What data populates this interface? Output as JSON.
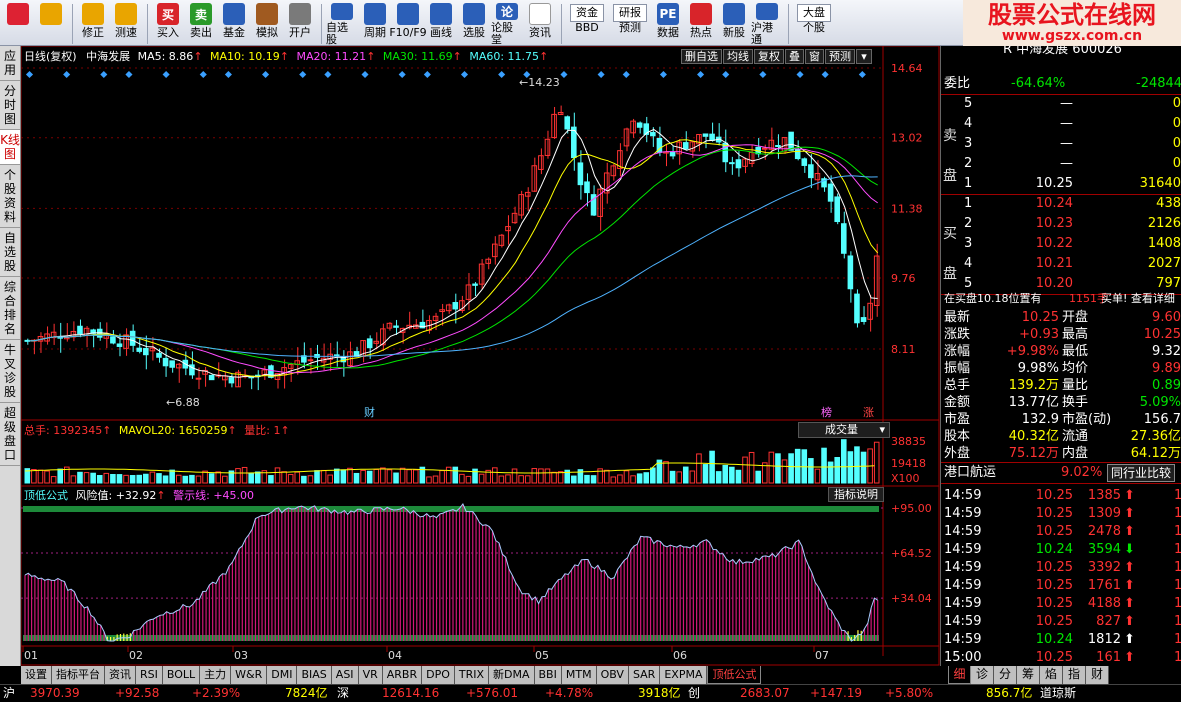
{
  "toolbar": {
    "buttons": [
      {
        "label": "",
        "icon": "window-icon",
        "color": "#d23",
        "name": "window-button"
      },
      {
        "label": "",
        "icon": "back-arrow-icon",
        "color": "#e9a500",
        "name": "back-button"
      },
      {
        "label": "修正",
        "icon": "up-arrow-icon",
        "color": "#e9a500",
        "name": "fix-button"
      },
      {
        "label": "测速",
        "icon": "clock-icon",
        "color": "#e9a500",
        "name": "speed-button"
      },
      {
        "label": "买入",
        "icon": "buy-icon",
        "color": "#d8242a",
        "name": "buy-button",
        "text": "买"
      },
      {
        "label": "卖出",
        "icon": "sell-icon",
        "color": "#2a9a2a",
        "name": "sell-button",
        "text": "卖"
      },
      {
        "label": "基金",
        "icon": "fund-icon",
        "color": "#2b5fb8",
        "name": "fund-button"
      },
      {
        "label": "模拟",
        "icon": "hammer-icon",
        "color": "#a05a20",
        "name": "simulate-button"
      },
      {
        "label": "开户",
        "icon": "lock-icon",
        "color": "#7a7a7a",
        "name": "open-account-button"
      },
      {
        "label": "自选股",
        "icon": "star-icon",
        "color": "#2b5fb8",
        "name": "watchlist-button"
      },
      {
        "label": "周期",
        "icon": "clock-cycle-icon",
        "color": "#2b5fb8",
        "name": "period-button"
      },
      {
        "label": "F10/F9",
        "icon": "f10-icon",
        "color": "#2b5fb8",
        "name": "f10-button"
      },
      {
        "label": "画线",
        "icon": "pencil-icon",
        "color": "#2b5fb8",
        "name": "draw-line-button"
      },
      {
        "label": "选股",
        "icon": "select-stock-icon",
        "color": "#2b5fb8",
        "name": "stock-picker-button"
      },
      {
        "label": "论股堂",
        "icon": "forum-icon",
        "color": "#2b5fb8",
        "name": "forum-button",
        "text": "论"
      },
      {
        "label": "资讯",
        "icon": "info-icon",
        "color": "#ffffff",
        "name": "news-button"
      },
      {
        "label": "BBD",
        "icon": "fund-flow-icon",
        "color": "#2b5fb8",
        "name": "bbd-button",
        "top": "资金"
      },
      {
        "label": "预测",
        "icon": "research-icon",
        "color": "#2b5fb8",
        "name": "forecast-button",
        "top": "研报"
      },
      {
        "label": "数据",
        "icon": "pe-icon",
        "color": "#2b5fb8",
        "name": "data-button",
        "text": "PE"
      },
      {
        "label": "热点",
        "icon": "hot-icon",
        "color": "#d8242a",
        "name": "hotspot-button"
      },
      {
        "label": "新股",
        "icon": "new-stock-icon",
        "color": "#2b5fb8",
        "name": "new-stock-button"
      },
      {
        "label": "沪港通",
        "icon": "hk-connect-icon",
        "color": "#2b5fb8",
        "name": "hk-connect-button"
      },
      {
        "label": "个股",
        "icon": "market-icon",
        "color": "#2b5fb8",
        "name": "market-button",
        "top": "大盘"
      }
    ],
    "brand": {
      "title": "股票公式在线网",
      "url": "www.gszx.com.cn"
    }
  },
  "left_tabs": [
    "应用",
    "分时图",
    "K线图",
    "个股资料",
    "自选股",
    "综合排名",
    "牛叉诊股",
    "超级盘口"
  ],
  "left_tab_active": "K线图",
  "chart": {
    "title_bar": {
      "period": "日线(复权)",
      "name": "中海发展",
      "ma5": "MA5: 8.86",
      "ma10": "MA10: 10.19",
      "ma20": "MA20: 11.21",
      "ma30": "MA30: 11.69",
      "ma60": "MA60: 11.75"
    },
    "top_buttons": [
      "删自选",
      "均线",
      "复权",
      "叠",
      "窗",
      "预测"
    ],
    "price_ticks": [
      "14.64",
      "13.02",
      "11.38",
      "9.76",
      "8.11"
    ],
    "high_label": "14.23",
    "low_label": "6.88",
    "markers": {
      "cai1": "财",
      "cai2": "财",
      "bang": "榜",
      "zhang": "涨"
    },
    "vol_title": {
      "total": "总手: 1392345",
      "mavol": "MAVOL20: 1650259",
      "ratio": "量比: 1"
    },
    "vol_select": "成交量",
    "vol_ticks": [
      "38835",
      "19418",
      "X100"
    ],
    "ind_title": {
      "name": "顶低公式",
      "risk": "风险值: +32.92",
      "warn": "警示线: +45.00"
    },
    "ind_button": "指标说明",
    "ind_ticks": [
      "+95.00",
      "+64.52",
      "+34.04"
    ],
    "months": [
      "01",
      "02",
      "03",
      "04",
      "05",
      "06",
      "07"
    ]
  },
  "chart_data": {
    "type": "candlestick",
    "title": "中海发展",
    "xlabel": "",
    "ylabel": "",
    "price_range": [
      6.88,
      14.64
    ],
    "high": 14.23,
    "low": 6.88,
    "ma": {
      "MA5": 8.86,
      "MA10": 10.19,
      "MA20": 11.21,
      "MA30": 11.69,
      "MA60": 11.75
    },
    "volume": {
      "total": 1392345,
      "MAVOL20": 1650259
    },
    "indicator": {
      "name": "顶低公式",
      "risk": 32.92,
      "warning": 45.0
    }
  },
  "right": {
    "header": "R 中海发展 600026",
    "weibi": {
      "label": "委比",
      "pct": "-64.64%",
      "diff": "-24844"
    },
    "sell_label": "卖盘",
    "buy_label": "买盘",
    "sell": [
      {
        "n": "5",
        "p": "—",
        "v": "0"
      },
      {
        "n": "4",
        "p": "—",
        "v": "0"
      },
      {
        "n": "3",
        "p": "—",
        "v": "0"
      },
      {
        "n": "2",
        "p": "—",
        "v": "0"
      },
      {
        "n": "1",
        "p": "10.25",
        "v": "31640"
      }
    ],
    "buy": [
      {
        "n": "1",
        "p": "10.24",
        "v": "438"
      },
      {
        "n": "2",
        "p": "10.23",
        "v": "2126"
      },
      {
        "n": "3",
        "p": "10.22",
        "v": "1408"
      },
      {
        "n": "4",
        "p": "10.21",
        "v": "2027"
      },
      {
        "n": "5",
        "p": "10.20",
        "v": "797"
      }
    ],
    "note": {
      "a": "在买盘10.18位置有",
      "b": "1151手",
      "c": "买单! 查看详细"
    },
    "stats": [
      {
        "l": "最新",
        "v": "10.25",
        "l2": "开盘",
        "v2": "9.60"
      },
      {
        "l": "涨跌",
        "v": "+0.93",
        "l2": "最高",
        "v2": "10.25"
      },
      {
        "l": "涨幅",
        "v": "+9.98%",
        "l2": "最低",
        "v2": "9.32"
      },
      {
        "l": "振幅",
        "v": "9.98%",
        "l2": "均价",
        "v2": "9.89"
      },
      {
        "l": "总手",
        "v": "139.2万",
        "l2": "量比",
        "v2": "0.89"
      },
      {
        "l": "金额",
        "v": "13.77亿",
        "l2": "换手",
        "v2": "5.09%"
      },
      {
        "l": "市盈",
        "v": "132.9",
        "l2": "市盈(动)",
        "v2": "156.7"
      },
      {
        "l": "股本",
        "v": "40.32亿",
        "l2": "流通",
        "v2": "27.36亿"
      },
      {
        "l": "外盘",
        "v": "75.12万",
        "l2": "内盘",
        "v2": "64.12万"
      }
    ],
    "industry": {
      "name": "港口航运",
      "pct": "9.02%",
      "btn": "同行业比较"
    },
    "ticks": [
      {
        "t": "14:59",
        "p": "10.25",
        "v": "1385",
        "d": "up"
      },
      {
        "t": "14:59",
        "p": "10.25",
        "v": "1309",
        "d": "up"
      },
      {
        "t": "14:59",
        "p": "10.25",
        "v": "2478",
        "d": "up"
      },
      {
        "t": "14:59",
        "p": "10.24",
        "v": "3594",
        "d": "down"
      },
      {
        "t": "14:59",
        "p": "10.25",
        "v": "3392",
        "d": "up"
      },
      {
        "t": "14:59",
        "p": "10.25",
        "v": "1761",
        "d": "up"
      },
      {
        "t": "14:59",
        "p": "10.25",
        "v": "4188",
        "d": "up"
      },
      {
        "t": "14:59",
        "p": "10.25",
        "v": "827",
        "d": "up"
      },
      {
        "t": "14:59",
        "p": "10.24",
        "v": "1812",
        "d": "flat"
      },
      {
        "t": "15:00",
        "p": "10.25",
        "v": "161",
        "d": "up"
      }
    ]
  },
  "bottom_tabs": [
    "设置",
    "指标平台",
    "资讯",
    "RSI",
    "BOLL",
    "主力",
    "W&R",
    "DMI",
    "BIAS",
    "ASI",
    "VR",
    "ARBR",
    "DPO",
    "TRIX",
    "新DMA",
    "BBI",
    "MTM",
    "OBV",
    "SAR",
    "EXPMA",
    "顶低公式"
  ],
  "bottom_tab_active": "顶低公式",
  "right_tabs": [
    "细",
    "诊",
    "分",
    "筹",
    "焰",
    "指",
    "财"
  ],
  "right_tab_active": "细",
  "status": {
    "sh_label": "沪",
    "sh_idx": "3970.39",
    "sh_chg": "+92.58",
    "sh_pct": "+2.39%",
    "sh_amt": "7824亿",
    "sz_label": "深",
    "sz_idx": "12614.16",
    "sz_chg": "+576.01",
    "sz_pct": "+4.78%",
    "sz_amt": "3918亿",
    "cy_label": "创",
    "cy_idx": "2683.07",
    "cy_chg": "+147.19",
    "cy_pct": "+5.80%",
    "cy_amt": "856.7亿",
    "dj_label": "道琼斯"
  }
}
